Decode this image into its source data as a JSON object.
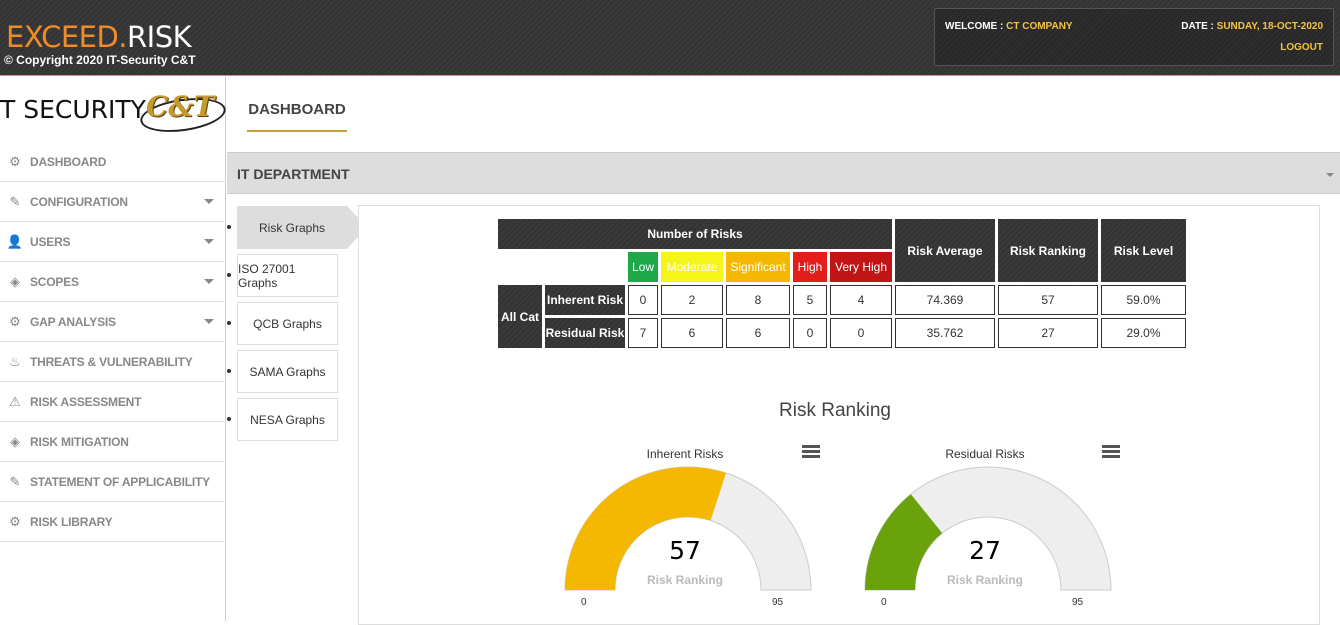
{
  "header": {
    "brand_part1": "EXCEED.",
    "brand_part2": "RISK",
    "copyright": "© Copyright 2020 IT-Security C&T",
    "welcome_label": "WELCOME : ",
    "welcome_value": "CT COMPANY",
    "date_label": "DATE : ",
    "date_value": "SUNDAY, 18-OCT-2020",
    "logout": "LOGOUT"
  },
  "sidebar": {
    "logo_text1": "T SECURITY",
    "logo_text2": "C&T",
    "items": [
      {
        "label": "DASHBOARD",
        "icon": "gear-icon",
        "glyph": "⚙",
        "caret": false
      },
      {
        "label": "CONFIGURATION",
        "icon": "pencil-icon",
        "glyph": "✎",
        "caret": true
      },
      {
        "label": "USERS",
        "icon": "user-icon",
        "glyph": "👤",
        "caret": true
      },
      {
        "label": "SCOPES",
        "icon": "layers-icon",
        "glyph": "◈",
        "caret": true
      },
      {
        "label": "GAP ANALYSIS",
        "icon": "gear-icon",
        "glyph": "⚙",
        "caret": true
      },
      {
        "label": "THREATS & VULNERABILITY",
        "icon": "fire-icon",
        "glyph": "♨",
        "caret": false
      },
      {
        "label": "RISK ASSESSMENT",
        "icon": "warning-icon",
        "glyph": "⚠",
        "caret": false
      },
      {
        "label": "RISK MITIGATION",
        "icon": "layers-icon",
        "glyph": "◈",
        "caret": false
      },
      {
        "label": "STATEMENT OF APPLICABILITY",
        "icon": "pencil-icon",
        "glyph": "✎",
        "caret": false
      },
      {
        "label": "RISK LIBRARY",
        "icon": "gear-icon",
        "glyph": "⚙",
        "caret": false
      }
    ]
  },
  "main": {
    "tab": "DASHBOARD",
    "section_title": "IT DEPARTMENT",
    "subtabs": [
      "Risk Graphs",
      "ISO 27001 Graphs",
      "QCB Graphs",
      "SAMA Graphs",
      "NESA Graphs"
    ],
    "active_subtab": 0
  },
  "risk_table": {
    "header_number": "Number of Risks",
    "header_average": "Risk Average",
    "header_ranking": "Risk Ranking",
    "header_level": "Risk Level",
    "levels": [
      "Low",
      "Moderate",
      "Significant",
      "High",
      "Very High"
    ],
    "category": "All Cat",
    "rows": [
      {
        "label": "Inherent Risk",
        "counts": [
          "0",
          "2",
          "8",
          "5",
          "4"
        ],
        "average": "74.369",
        "ranking": "57",
        "level": "59.0%"
      },
      {
        "label": "Residual Risk",
        "counts": [
          "7",
          "6",
          "6",
          "0",
          "0"
        ],
        "average": "35.762",
        "ranking": "27",
        "level": "29.0%"
      }
    ]
  },
  "charts_title": "Risk Ranking",
  "chart_data": [
    {
      "type": "gauge",
      "title": "Inherent Risks",
      "value": 57,
      "min": 0,
      "max": 95,
      "label": "Risk Ranking",
      "color": "#f5b800"
    },
    {
      "type": "gauge",
      "title": "Residual Risks",
      "value": 27,
      "min": 0,
      "max": 95,
      "label": "Risk Ranking",
      "color": "#6aa20c"
    }
  ]
}
